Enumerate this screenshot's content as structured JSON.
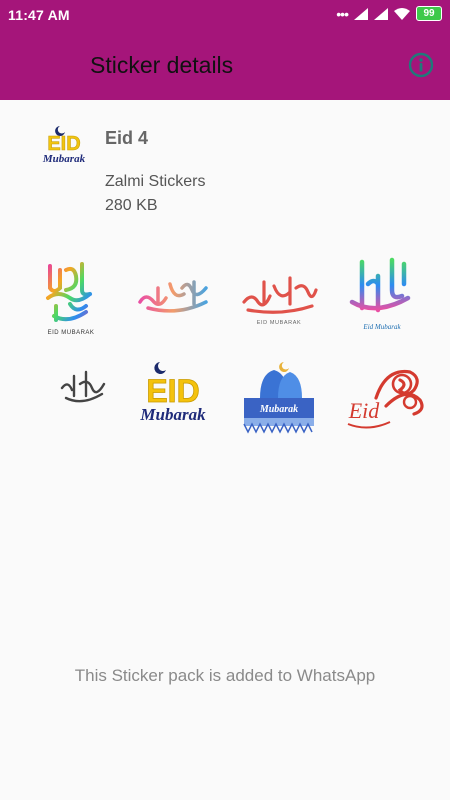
{
  "status_bar": {
    "time": "11:47 AM",
    "battery": "99"
  },
  "appbar": {
    "title": "Sticker details",
    "info_icon": "info-icon"
  },
  "pack": {
    "name": "Eid 4",
    "publisher": "Zalmi Stickers",
    "size": "280 KB",
    "tray_text": "EID",
    "tray_subtext": "Mubarak"
  },
  "stickers": [
    {
      "id": "sticker-1",
      "caption": "EID MUBARAK"
    },
    {
      "id": "sticker-2",
      "caption": ""
    },
    {
      "id": "sticker-3",
      "caption": "EID MUBARAK"
    },
    {
      "id": "sticker-4",
      "caption": "Eid Mubarak"
    },
    {
      "id": "sticker-5",
      "caption": ""
    },
    {
      "id": "sticker-6",
      "caption": "EID",
      "caption2": "Mubarak"
    },
    {
      "id": "sticker-7",
      "caption": "Mubarak"
    },
    {
      "id": "sticker-8",
      "caption": "Eid"
    }
  ],
  "footer": {
    "added_text": "This Sticker pack is added to WhatsApp"
  },
  "colors": {
    "appbar": "#a5157a",
    "accent_info": "#1f7a7a"
  }
}
